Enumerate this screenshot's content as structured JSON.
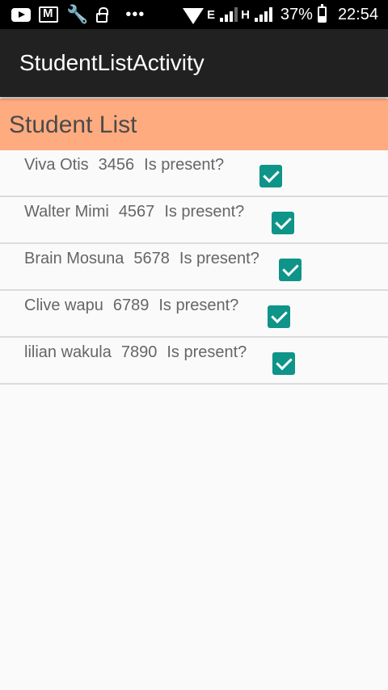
{
  "status_bar": {
    "icons_left": [
      "youtube-icon",
      "mail-icon",
      "wrench-icon",
      "lock-icon",
      "more-dots-icon"
    ],
    "network_labels": [
      "E",
      "H"
    ],
    "battery": "37%",
    "time": "22:54"
  },
  "app_bar": {
    "title": "StudentListActivity"
  },
  "header": {
    "title": "Student List"
  },
  "students": [
    {
      "name": "Viva Otis",
      "id": "3456",
      "question": "Is present?",
      "present": true
    },
    {
      "name": "Walter Mimi",
      "id": "4567",
      "question": "Is present?",
      "present": true
    },
    {
      "name": "Brain Mosuna",
      "id": "5678",
      "question": "Is present?",
      "present": true
    },
    {
      "name": "Clive wapu",
      "id": "6789",
      "question": "Is present?",
      "present": true
    },
    {
      "name": "lilian wakula",
      "id": "7890",
      "question": "Is present?",
      "present": true
    }
  ],
  "colors": {
    "status_bar": "#000000",
    "app_bar": "#212121",
    "header_bg": "#ffab80",
    "checkbox": "#0e9488",
    "background": "#fafafa"
  }
}
